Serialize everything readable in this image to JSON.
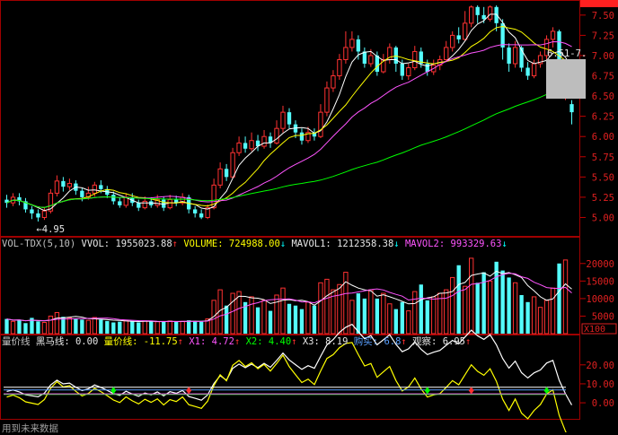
{
  "chart_data": {
    "type": "candlestick",
    "price_axis": {
      "ticks": [
        "7.50",
        "7.25",
        "7.00",
        "6.75",
        "6.50",
        "6.25",
        "6.00",
        "5.75",
        "5.50",
        "5.25",
        "5.00"
      ],
      "min": 4.85,
      "max": 7.62
    },
    "annotations": {
      "low_label": "4.95",
      "range_label": "6.51-7."
    },
    "volume_header": {
      "title": "VOL-TDX(5,10)",
      "vvol_label": "VVOL:",
      "vvol_value": "1955023.88",
      "volume_label": "VOLUME:",
      "volume_value": "724988.00",
      "mavol1_label": "MAVOL1:",
      "mavol1_value": "1212358.38",
      "mavol2_label": "MAVOL2:",
      "mavol2_value": "993329.63"
    },
    "volume_axis": {
      "ticks": [
        "20000",
        "15000",
        "10000",
        "5000"
      ],
      "unit": "X100",
      "max": 22500
    },
    "indicator_header": {
      "title": "量价线",
      "heima_label": "黑马线:",
      "heima_value": "0.00",
      "ljx_label": "量价线:",
      "ljx_value": "-11.75",
      "x1_label": "X1:",
      "x1_value": "4.72",
      "x2_label": "X2:",
      "x2_value": "4.40",
      "x3_label": "X3:",
      "x3_value": "8.19",
      "x4_label": "购买:",
      "x4_value": "6.8",
      "gc_label": "观察:",
      "gc_value": "6.95"
    },
    "indicator_axis": {
      "ticks": [
        "20.00",
        "10.00",
        "0.00"
      ],
      "min": -8,
      "max": 27
    },
    "candles": [
      [
        5.22,
        5.18,
        5.28,
        5.12
      ],
      [
        5.18,
        5.25,
        5.3,
        5.14
      ],
      [
        5.25,
        5.2,
        5.3,
        5.15
      ],
      [
        5.2,
        5.1,
        5.24,
        5.06
      ],
      [
        5.1,
        5.05,
        5.14,
        4.98
      ],
      [
        5.05,
        5.0,
        5.1,
        4.95
      ],
      [
        5.0,
        5.08,
        5.12,
        4.97
      ],
      [
        5.08,
        5.3,
        5.35,
        5.05
      ],
      [
        5.3,
        5.45,
        5.52,
        5.26
      ],
      [
        5.45,
        5.38,
        5.5,
        5.32
      ],
      [
        5.38,
        5.42,
        5.48,
        5.34
      ],
      [
        5.42,
        5.33,
        5.46,
        5.28
      ],
      [
        5.33,
        5.25,
        5.36,
        5.2
      ],
      [
        5.25,
        5.3,
        5.38,
        5.22
      ],
      [
        5.3,
        5.4,
        5.44,
        5.26
      ],
      [
        5.4,
        5.35,
        5.46,
        5.3
      ],
      [
        5.35,
        5.28,
        5.39,
        5.24
      ],
      [
        5.28,
        5.2,
        5.32,
        5.16
      ],
      [
        5.2,
        5.15,
        5.25,
        5.12
      ],
      [
        5.15,
        5.25,
        5.3,
        5.12
      ],
      [
        5.25,
        5.18,
        5.3,
        5.14
      ],
      [
        5.18,
        5.12,
        5.22,
        5.08
      ],
      [
        5.12,
        5.2,
        5.26,
        5.1
      ],
      [
        5.2,
        5.15,
        5.25,
        5.12
      ],
      [
        5.15,
        5.22,
        5.28,
        5.12
      ],
      [
        5.22,
        5.12,
        5.26,
        5.08
      ],
      [
        5.12,
        5.22,
        5.28,
        5.1
      ],
      [
        5.22,
        5.18,
        5.27,
        5.14
      ],
      [
        5.18,
        5.25,
        5.3,
        5.15
      ],
      [
        5.25,
        5.1,
        5.28,
        5.05
      ],
      [
        5.1,
        5.05,
        5.14,
        5.0
      ],
      [
        5.05,
        5.0,
        5.1,
        4.98
      ],
      [
        5.0,
        5.12,
        5.16,
        4.98
      ],
      [
        5.12,
        5.4,
        5.48,
        5.1
      ],
      [
        5.4,
        5.6,
        5.68,
        5.36
      ],
      [
        5.6,
        5.5,
        5.66,
        5.45
      ],
      [
        5.5,
        5.8,
        5.86,
        5.48
      ],
      [
        5.8,
        5.92,
        6.0,
        5.76
      ],
      [
        5.92,
        5.85,
        6.0,
        5.8
      ],
      [
        5.85,
        5.95,
        6.05,
        5.82
      ],
      [
        5.95,
        5.88,
        6.02,
        5.82
      ],
      [
        5.88,
        6.0,
        6.08,
        5.85
      ],
      [
        6.0,
        5.92,
        6.05,
        5.86
      ],
      [
        5.92,
        6.1,
        6.2,
        5.9
      ],
      [
        6.1,
        6.3,
        6.38,
        6.05
      ],
      [
        6.3,
        6.15,
        6.35,
        6.1
      ],
      [
        6.15,
        6.05,
        6.2,
        5.98
      ],
      [
        6.05,
        5.95,
        6.1,
        5.9
      ],
      [
        5.95,
        6.05,
        6.12,
        5.92
      ],
      [
        6.05,
        6.0,
        6.1,
        5.95
      ],
      [
        6.0,
        6.3,
        6.4,
        5.98
      ],
      [
        6.3,
        6.6,
        6.68,
        6.25
      ],
      [
        6.6,
        6.75,
        6.82,
        6.55
      ],
      [
        6.75,
        6.95,
        7.02,
        6.7
      ],
      [
        6.95,
        7.1,
        7.3,
        6.9
      ],
      [
        7.1,
        7.2,
        7.3,
        7.05
      ],
      [
        7.2,
        7.05,
        7.25,
        6.95
      ],
      [
        7.05,
        6.9,
        7.1,
        6.85
      ],
      [
        6.9,
        7.0,
        7.08,
        6.86
      ],
      [
        7.0,
        6.8,
        7.05,
        6.75
      ],
      [
        6.8,
        6.95,
        7.02,
        6.78
      ],
      [
        6.95,
        7.1,
        7.15,
        6.9
      ],
      [
        7.1,
        6.9,
        7.12,
        6.8
      ],
      [
        6.9,
        6.75,
        6.95,
        6.7
      ],
      [
        6.75,
        6.85,
        6.9,
        6.7
      ],
      [
        6.85,
        7.05,
        7.12,
        6.82
      ],
      [
        7.05,
        6.9,
        7.1,
        6.85
      ],
      [
        6.9,
        6.8,
        6.95,
        6.75
      ],
      [
        6.8,
        6.88,
        6.95,
        6.76
      ],
      [
        6.88,
        6.95,
        7.0,
        6.82
      ],
      [
        6.95,
        7.1,
        7.18,
        6.92
      ],
      [
        7.1,
        7.25,
        7.3,
        7.05
      ],
      [
        7.25,
        7.2,
        7.35,
        7.15
      ],
      [
        7.2,
        7.4,
        7.55,
        7.18
      ],
      [
        7.4,
        7.6,
        7.62,
        7.35
      ],
      [
        7.6,
        7.5,
        7.62,
        7.4
      ],
      [
        7.5,
        7.45,
        7.6,
        7.4
      ],
      [
        7.45,
        7.6,
        7.62,
        7.42
      ],
      [
        7.6,
        7.4,
        7.62,
        7.3
      ],
      [
        7.4,
        7.1,
        7.45,
        6.95
      ],
      [
        7.1,
        6.9,
        7.15,
        6.8
      ],
      [
        6.9,
        7.1,
        7.18,
        6.85
      ],
      [
        7.1,
        6.85,
        7.12,
        6.8
      ],
      [
        6.85,
        6.75,
        6.92,
        6.7
      ],
      [
        6.75,
        6.9,
        6.95,
        6.72
      ],
      [
        6.9,
        7.0,
        7.05,
        6.85
      ],
      [
        7.0,
        7.2,
        7.25,
        6.95
      ],
      [
        7.2,
        7.3,
        7.35,
        7.1
      ],
      [
        7.3,
        6.85,
        7.32,
        6.8
      ],
      [
        6.5,
        6.55,
        6.6,
        6.45
      ],
      [
        6.4,
        6.3,
        6.45,
        6.15
      ]
    ],
    "volumes": [
      4200,
      3500,
      4000,
      3000,
      4500,
      3500,
      3200,
      5000,
      6000,
      4800,
      4500,
      4200,
      4000,
      3800,
      4600,
      4000,
      3600,
      3200,
      3400,
      3800,
      3600,
      3200,
      3600,
      3500,
      3400,
      3400,
      3600,
      3400,
      3500,
      3800,
      3500,
      3400,
      4200,
      9500,
      12500,
      8000,
      11500,
      12000,
      9000,
      10500,
      7500,
      9500,
      6500,
      11000,
      13000,
      8500,
      8000,
      7000,
      9000,
      8000,
      14500,
      15500,
      12500,
      14000,
      17500,
      9500,
      11500,
      10000,
      12500,
      10000,
      11500,
      8500,
      7000,
      9000,
      6500,
      12000,
      14000,
      9500,
      10500,
      11500,
      12500,
      16000,
      19500,
      13500,
      21500,
      14500,
      17500,
      15000,
      20500,
      18000,
      16000,
      14500,
      11000,
      9000,
      10500,
      7500,
      9500,
      13000,
      20000,
      21000,
      0
    ]
  }
}
